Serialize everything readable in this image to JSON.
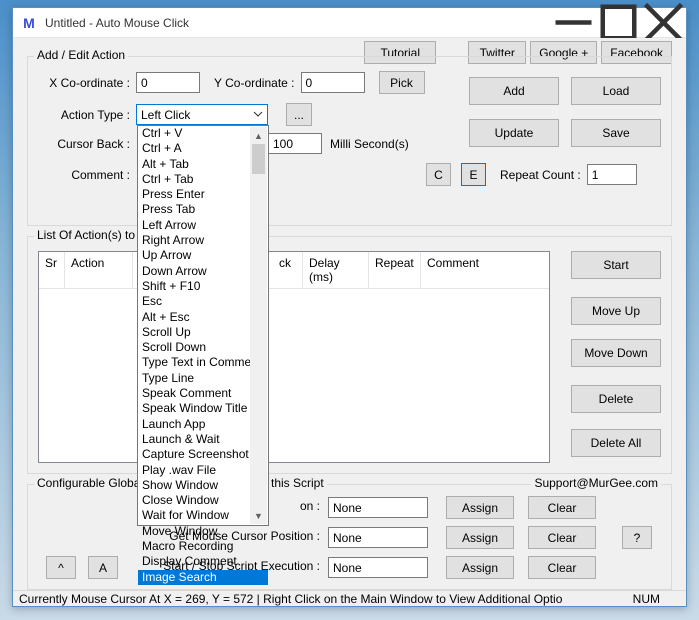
{
  "title": "Untitled - Auto Mouse Click",
  "top_buttons": {
    "tutorial": "Tutorial",
    "twitter": "Twitter",
    "google": "Google +",
    "facebook": "Facebook"
  },
  "panel_title": "Add / Edit Action",
  "labels": {
    "x": "X Co-ordinate :",
    "y": "Y Co-ordinate :",
    "pick": "Pick",
    "action_type": "Action Type :",
    "ellipsis": "...",
    "cursor_back": "Cursor Back :",
    "ms": "Milli Second(s)",
    "comment": "Comment :",
    "c": "C",
    "e": "E",
    "repeat": "Repeat Count :",
    "list": "List Of Action(s) to",
    "config": "Configurable Global",
    "this_script": "this Script",
    "support": "Support@MurGee.com",
    "gl": "Gl",
    "on": "on :",
    "getpos": "Get Mouse Cursor Position :",
    "startstop": "Start / Stop Script Execution :",
    "assign": "Assign",
    "clear": "Clear",
    "none": "None",
    "q": "?",
    "caret": "^",
    "a": "A"
  },
  "values": {
    "x": "0",
    "y": "0",
    "delay": "100",
    "repeat": "1",
    "action_type": "Left Click"
  },
  "side_buttons": {
    "add": "Add",
    "load": "Load",
    "update": "Update",
    "save": "Save",
    "start": "Start",
    "moveup": "Move Up",
    "movedown": "Move Down",
    "delete": "Delete",
    "deleteall": "Delete All"
  },
  "grid_headers": [
    "Sr",
    "Action",
    "ck",
    "Delay (ms)",
    "Repeat",
    "Comment"
  ],
  "dropdown_items": [
    "Ctrl + V",
    "Ctrl + A",
    "Alt + Tab",
    "Ctrl + Tab",
    "Press Enter",
    "Press Tab",
    "Left Arrow",
    "Right Arrow",
    "Up Arrow",
    "Down Arrow",
    "Shift + F10",
    "Esc",
    "Alt + Esc",
    "Scroll Up",
    "Scroll Down",
    "Type Text in Comment",
    "Type Line",
    "Speak Comment",
    "Speak Window Title",
    "Launch App",
    "Launch & Wait",
    "Capture Screenshot",
    "Play .wav File",
    "Show Window",
    "Close Window",
    "Wait for Window",
    "Move Window",
    "Macro Recording",
    "Display Comment",
    "Image Search"
  ],
  "highlighted_item_index": 29,
  "status": {
    "text": "Currently Mouse Cursor At X = 269, Y = 572 | Right Click on the Main Window to View Additional Optio",
    "num": "NUM"
  }
}
